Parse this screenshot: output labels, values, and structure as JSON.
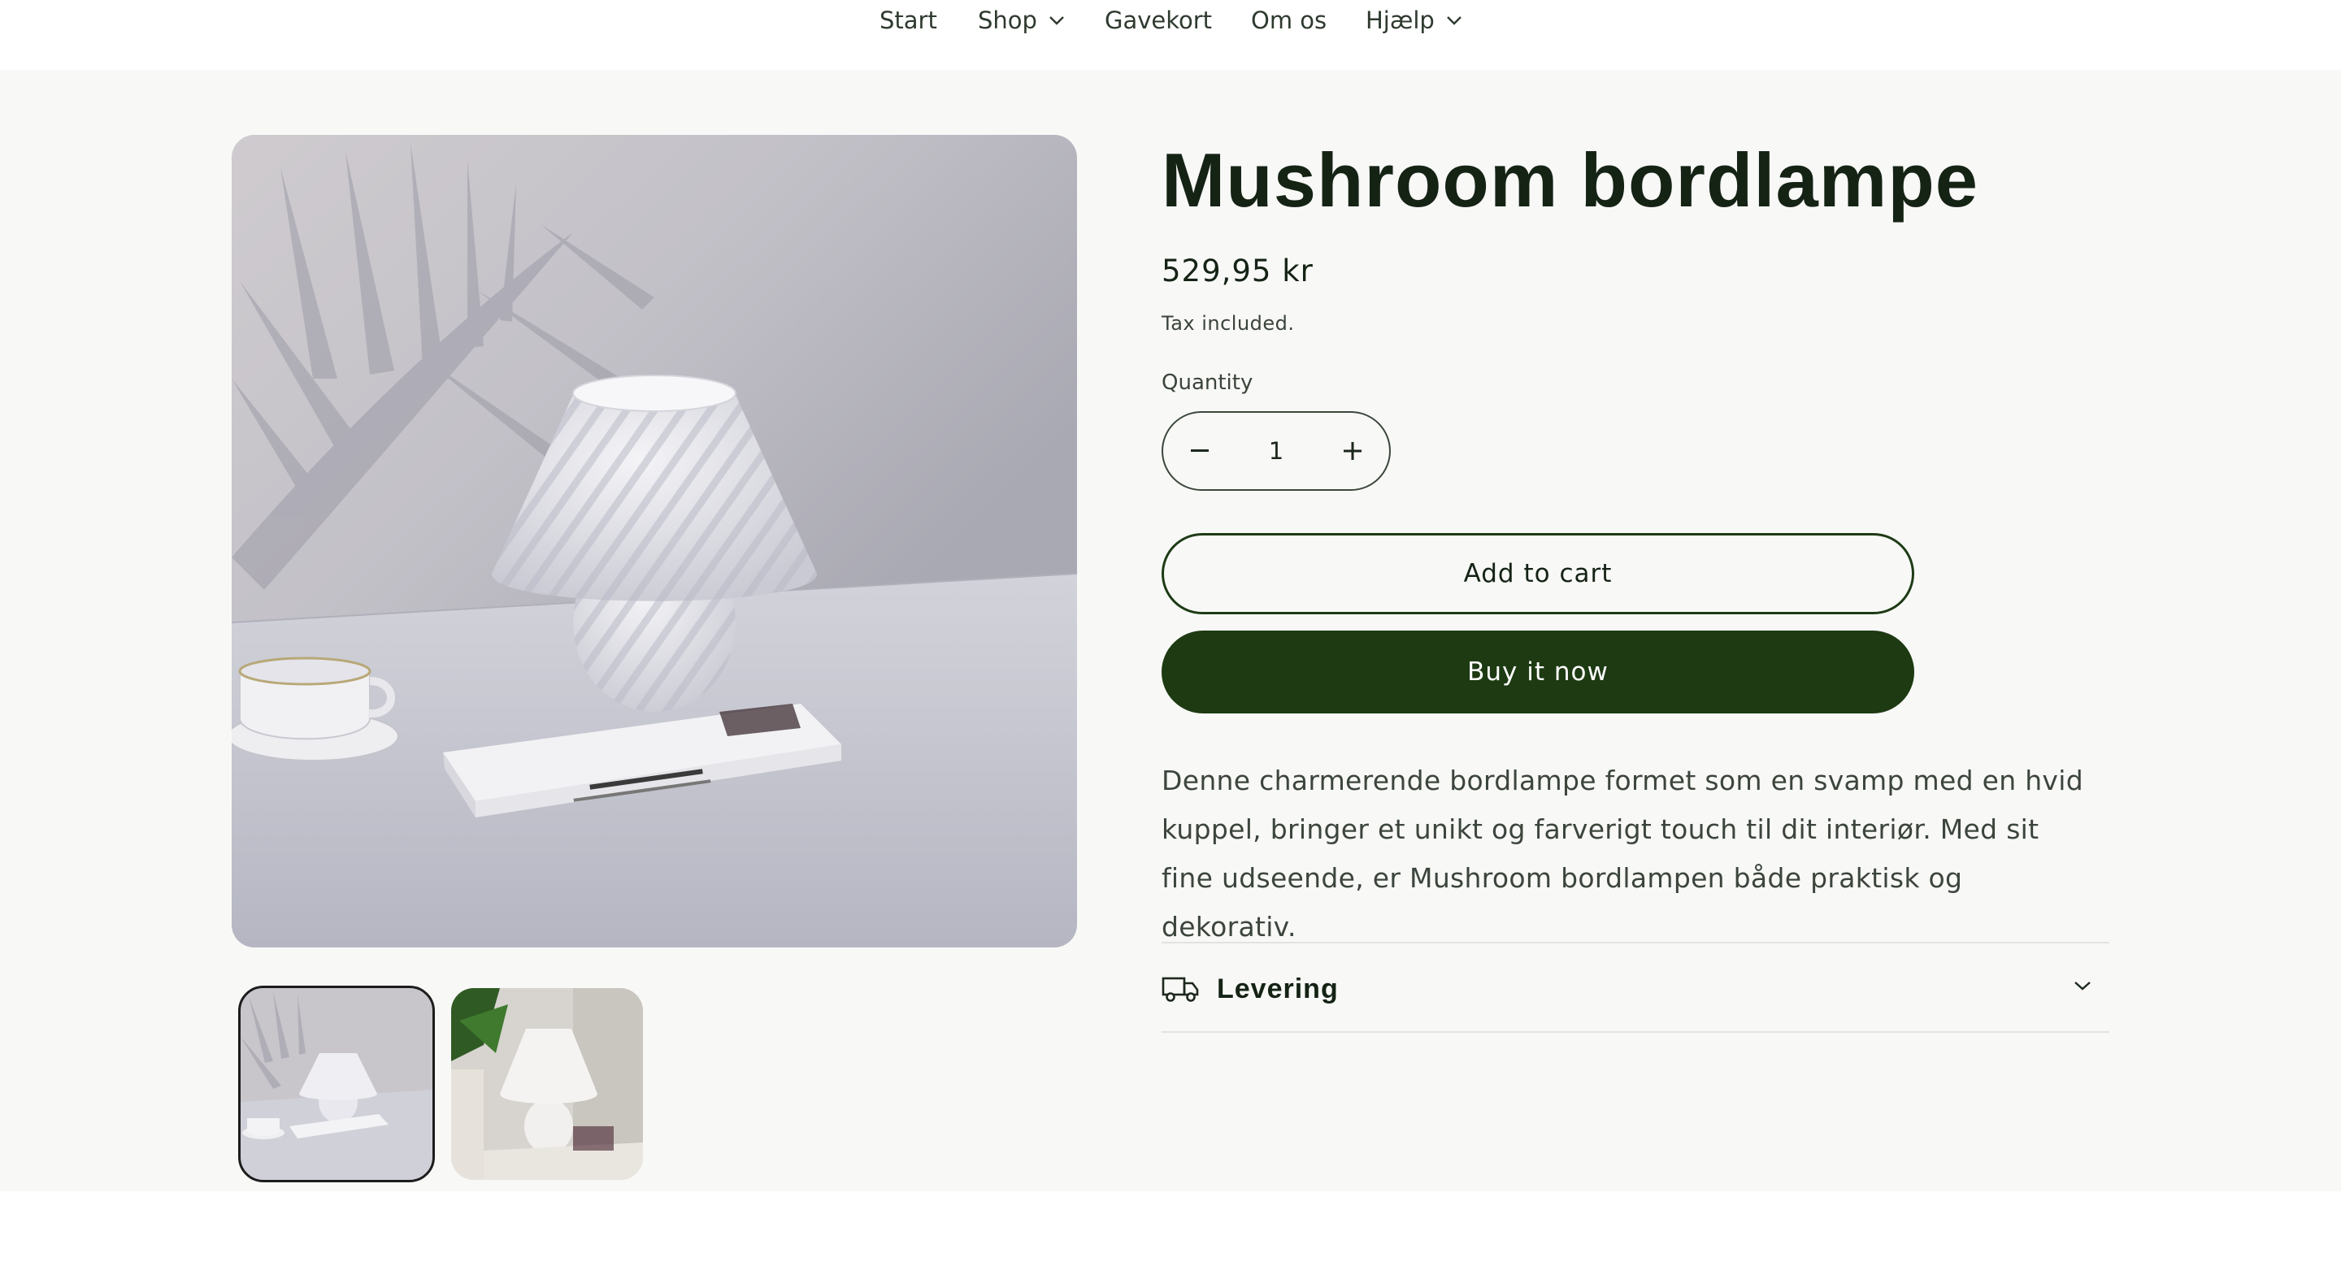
{
  "nav": {
    "items": [
      {
        "label": "Start",
        "has_dropdown": false
      },
      {
        "label": "Shop",
        "has_dropdown": true
      },
      {
        "label": "Gavekort",
        "has_dropdown": false
      },
      {
        "label": "Om os",
        "has_dropdown": false
      },
      {
        "label": "Hjælp",
        "has_dropdown": true
      }
    ]
  },
  "product": {
    "title": "Mushroom bordlampe",
    "price": "529,95 kr",
    "tax_note": "Tax included.",
    "quantity_label": "Quantity",
    "quantity_value": "1",
    "add_to_cart_label": "Add to cart",
    "buy_now_label": "Buy it now",
    "description": "Denne charmerende bordlampe formet som en svamp med en hvid kuppel, bringer et unikt og farverigt touch til dit interiør. Med sit fine udseende, er Mushroom bordlampen både praktisk og dekorativ.",
    "accordion": {
      "label": "Levering",
      "icon": "truck-icon",
      "expanded": false
    }
  },
  "gallery": {
    "main_image": "mushroom-lamp-photo",
    "thumbnails": [
      "mushroom-lamp-thumbnail-1",
      "mushroom-lamp-thumbnail-2"
    ],
    "selected_index": 0
  },
  "colors": {
    "brand_dark_green": "#1d3a12",
    "page_background": "#f8f8f7",
    "text": "#152315"
  }
}
